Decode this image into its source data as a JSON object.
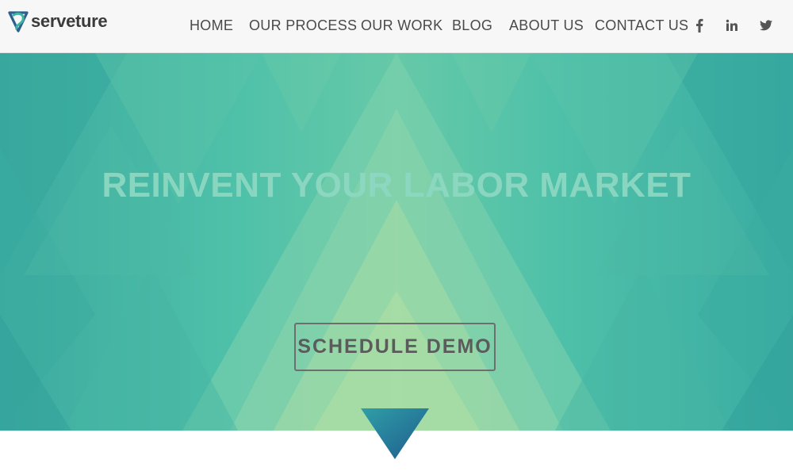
{
  "brand": {
    "name": "serveture",
    "logo_icon": "serveture-logo-icon"
  },
  "nav": {
    "items": [
      {
        "label": "HOME"
      },
      {
        "label": "OUR PROCESS"
      },
      {
        "label": "OUR WORK"
      },
      {
        "label": "BLOG"
      },
      {
        "label": "ABOUT US"
      },
      {
        "label": "CONTACT US"
      }
    ],
    "social": [
      {
        "icon": "facebook-icon",
        "glyph": "f"
      },
      {
        "icon": "linkedin-icon",
        "glyph": "in"
      },
      {
        "icon": "twitter-icon",
        "glyph": "twitter-bird"
      }
    ]
  },
  "hero": {
    "headline": "REINVENT YOUR LABOR MARKET",
    "cta_label": "SCHEDULE DEMO",
    "scroll_icon": "down-arrow-icon"
  },
  "colors": {
    "hero_teal": "#3daaa0",
    "hero_green": "#66c9a8",
    "hero_light": "#a8dca4",
    "headline": "#8dd8c2",
    "nav_text": "#4a4a4a",
    "arrow_top": "#2f9fa6",
    "arrow_bottom": "#1f5b8f"
  }
}
